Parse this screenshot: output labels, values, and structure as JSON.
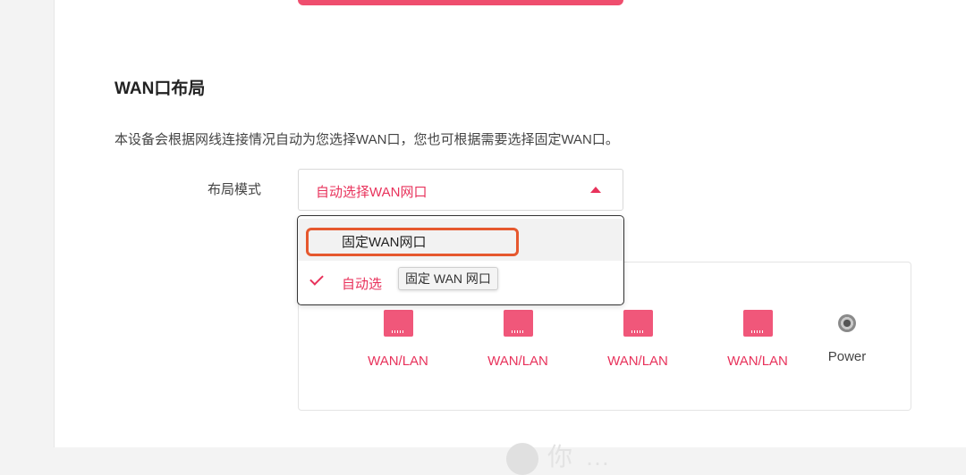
{
  "section": {
    "title": "WAN口布局",
    "description": "本设备会根据网线连接情况自动为您选择WAN口，您也可根据需要选择固定WAN口。"
  },
  "layout_mode": {
    "label": "布局模式",
    "selected_value": "自动选择WAN网口",
    "options": [
      {
        "label": "固定WAN网口",
        "selected": false
      },
      {
        "label": "自动选",
        "selected": true
      }
    ]
  },
  "tooltip": "固定 WAN 网口",
  "ports": [
    {
      "label": "WAN/LAN",
      "icon": "ethernet-port-icon"
    },
    {
      "label": "WAN/LAN",
      "icon": "ethernet-port-icon"
    },
    {
      "label": "WAN/LAN",
      "icon": "ethernet-port-icon"
    },
    {
      "label": "WAN/LAN",
      "icon": "ethernet-port-icon"
    },
    {
      "label": "Power",
      "icon": "power-port-icon"
    }
  ],
  "bottom_text": "你…",
  "colors": {
    "accent": "#e8325b",
    "highlight": "#e6582e"
  }
}
